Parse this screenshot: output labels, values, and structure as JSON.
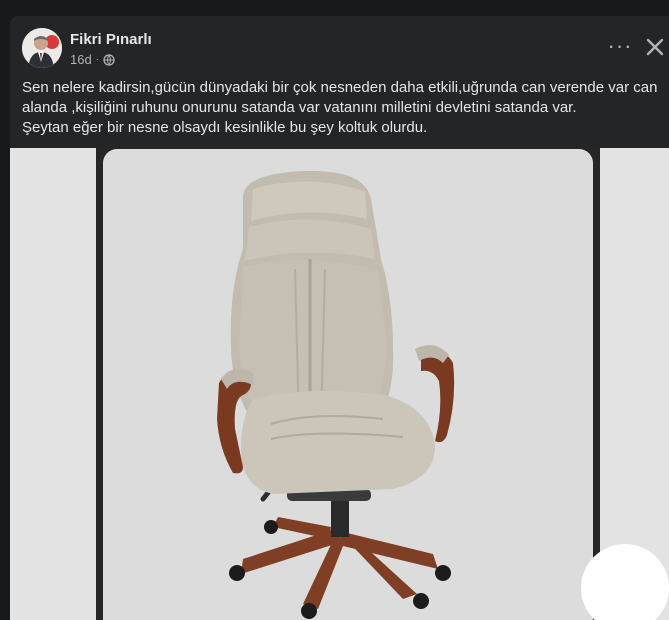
{
  "post": {
    "author": "Fikri Pınarlı",
    "time": "16d",
    "separator": "·",
    "audience_icon": "globe-icon",
    "more_icon": "more-horizontal-icon",
    "more_label": "···",
    "close_icon": "close-icon",
    "text_lines": [
      "Sen nelere kadirsin,gücün dünyadaki bir çok nesneden daha etkili,uğrunda can verende var can",
      "alanda ,kişiliğini ruhunu onurunu satanda var vatanını milletini devletini satanda var.",
      "Şeytan eğer bir nesne olsaydı kesinlikle bu şey koltuk olurdu."
    ],
    "image_subject": "office-chair-photo"
  },
  "colors": {
    "page_bg": "#18191a",
    "card_bg": "#242526",
    "primary_text": "#e4e6eb",
    "secondary_text": "#b0b3b8"
  }
}
